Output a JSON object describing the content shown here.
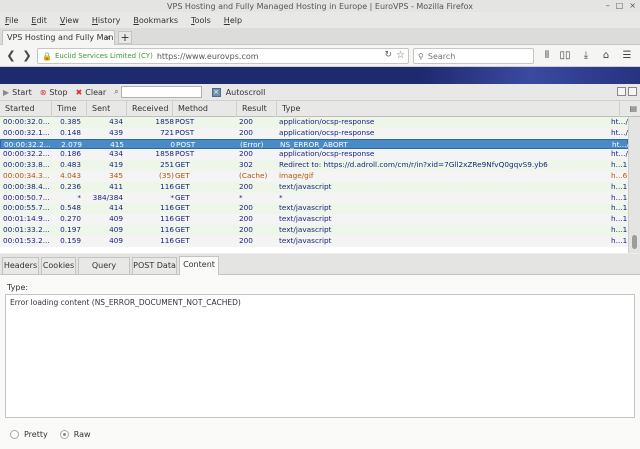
{
  "window": {
    "title": "VPS Hosting and Fully Managed Hosting in Europe | EuroVPS - Mozilla Firefox"
  },
  "menu": [
    {
      "label": "File",
      "u": "F",
      "rest": "ile"
    },
    {
      "label": "Edit",
      "u": "E",
      "rest": "dit"
    },
    {
      "label": "View",
      "u": "V",
      "rest": "iew"
    },
    {
      "label": "History",
      "u": "H",
      "rest": "istory"
    },
    {
      "label": "Bookmarks",
      "u": "B",
      "rest": "ookmarks"
    },
    {
      "label": "Tools",
      "u": "T",
      "rest": "ools"
    },
    {
      "label": "Help",
      "u": "H",
      "rest": "elp"
    }
  ],
  "tab": {
    "label": "VPS Hosting and Fully Manag",
    "close": "×",
    "new_tab": "+"
  },
  "nav": {
    "org": "Euclid Services Limited (CY)",
    "url": "https://www.eurovps.com",
    "search_placeholder": "Search"
  },
  "toolbar": {
    "start": "Start",
    "stop": "Stop",
    "clear": "Clear",
    "autoscroll": "Autoscroll",
    "filter_value": ""
  },
  "columns": [
    "Started",
    "Time",
    "Sent",
    "Received",
    "Method",
    "Result",
    "Type"
  ],
  "rows": [
    {
      "started": "00:00:32.0...",
      "time": "0.385",
      "sent": "434",
      "received": "1858",
      "method": "POST",
      "result": "200",
      "type": "application/ocsp-response",
      "host": "ht.../",
      "style": "even"
    },
    {
      "started": "00:00:32.1...",
      "time": "0.148",
      "sent": "439",
      "received": "721",
      "method": "POST",
      "result": "200",
      "type": "application/ocsp-response",
      "host": "ht.../",
      "style": "odd"
    },
    {
      "started": "00:00:32.2...",
      "time": "2.079",
      "sent": "415",
      "received": "0",
      "method": "POST",
      "result": "(Error)",
      "type": "NS_ERROR_ABORT",
      "host": "ht.../",
      "style": "selected"
    },
    {
      "started": "00:00:32.2...",
      "time": "0.186",
      "sent": "434",
      "received": "1858",
      "method": "POST",
      "result": "200",
      "type": "application/ocsp-response",
      "host": "ht.../",
      "style": "odd"
    },
    {
      "started": "00:00:33.8...",
      "time": "0.483",
      "sent": "419",
      "received": "251",
      "method": "GET",
      "result": "302",
      "type": "Redirect to: https://d.adroll.com/cm/r/in?xid=7Gll2xZRe9NfvQ0gqvS9.yb6",
      "host": "h...1",
      "style": "even"
    },
    {
      "started": "00:00:34.3...",
      "time": "4.043",
      "sent": "345",
      "received": "(35)",
      "method": "GET",
      "result": "(Cache)",
      "type": "image/gif",
      "host": "h...6",
      "style": "odd"
    },
    {
      "started": "00:00:38.4...",
      "time": "0.236",
      "sent": "411",
      "received": "116",
      "method": "GET",
      "result": "200",
      "type": "text/javascript",
      "host": "h...1",
      "style": "even"
    },
    {
      "started": "00:00:50.7...",
      "time": "*",
      "sent": "384/384",
      "received": "*",
      "method": "GET",
      "result": "*",
      "type": "*",
      "host": "h...1",
      "style": "odd"
    },
    {
      "started": "00:00:55.7...",
      "time": "0.548",
      "sent": "414",
      "received": "116",
      "method": "GET",
      "result": "200",
      "type": "text/javascript",
      "host": "h...1",
      "style": "even"
    },
    {
      "started": "00:01:14.9...",
      "time": "0.270",
      "sent": "409",
      "received": "116",
      "method": "GET",
      "result": "200",
      "type": "text/javascript",
      "host": "h...1",
      "style": "odd"
    },
    {
      "started": "00:01:33.2...",
      "time": "0.197",
      "sent": "409",
      "received": "116",
      "method": "GET",
      "result": "200",
      "type": "text/javascript",
      "host": "h...1",
      "style": "even"
    },
    {
      "started": "00:01:53.2...",
      "time": "0.159",
      "sent": "409",
      "received": "116",
      "method": "GET",
      "result": "200",
      "type": "text/javascript",
      "host": "h...1",
      "style": "odd"
    }
  ],
  "detail_tabs": [
    "Headers",
    "Cookies",
    "Query String",
    "POST Data",
    "Content"
  ],
  "detail": {
    "type_label": "Type:",
    "content": "Error loading content (NS_ERROR_DOCUMENT_NOT_CACHED)",
    "pretty": "Pretty",
    "raw": "Raw"
  },
  "colors": {
    "selected": "#4a8ac5",
    "row_even": "#eef6ea",
    "row_odd": "#f4f4f4",
    "text": "#1a237e",
    "banner": "#1e2a6e"
  }
}
